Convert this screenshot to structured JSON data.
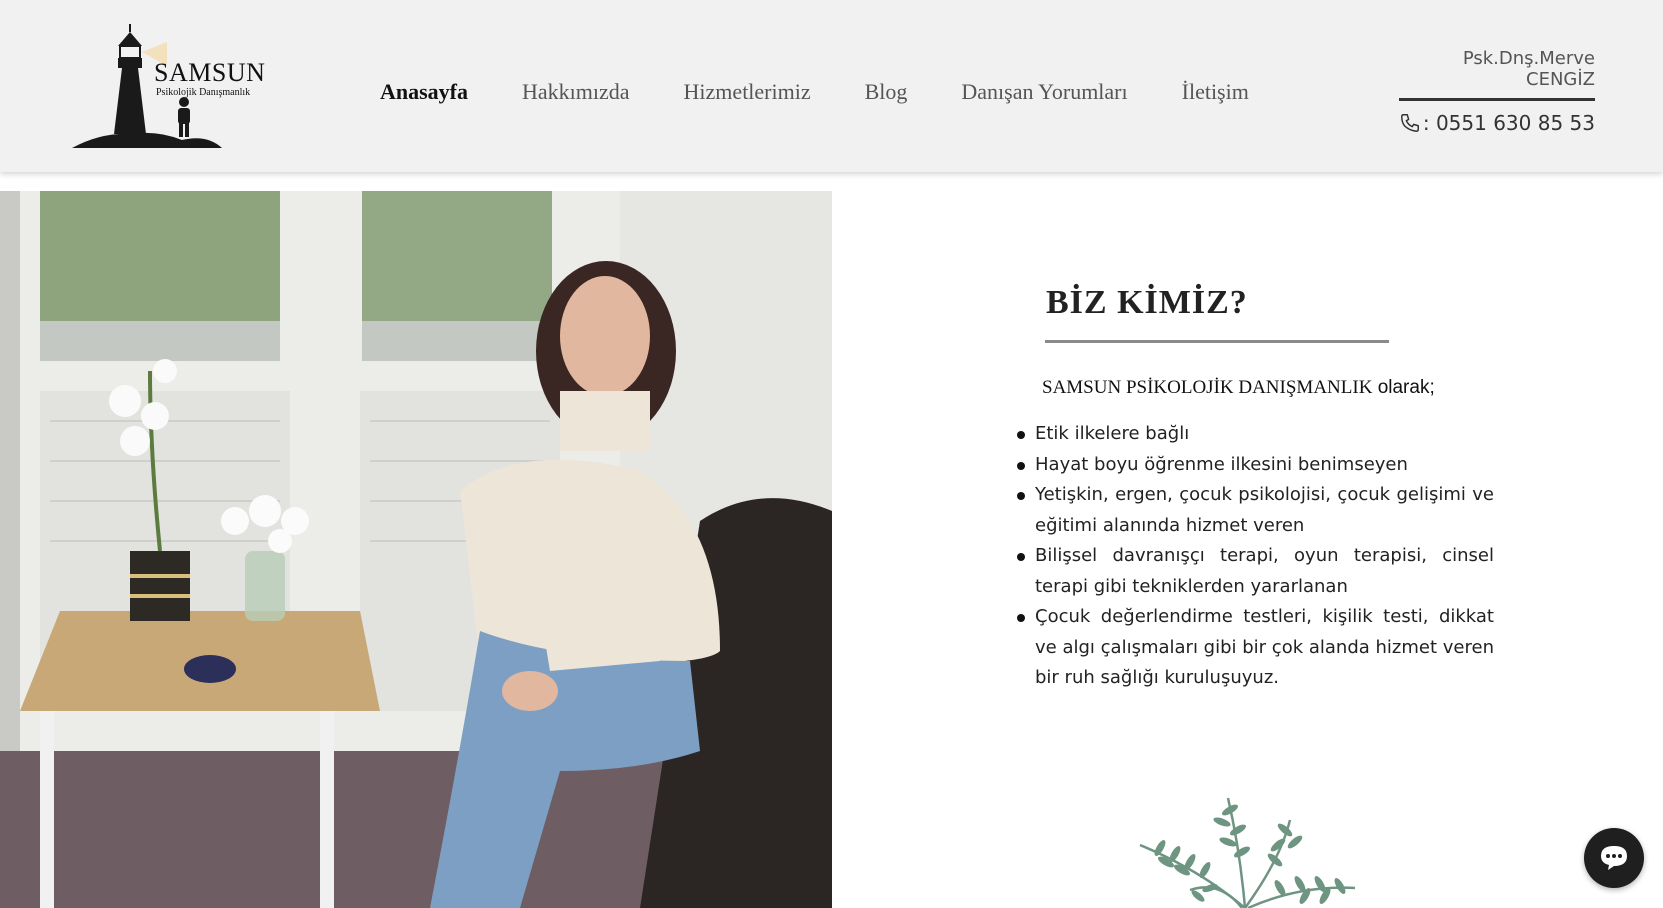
{
  "header": {
    "logo": {
      "title": "SAMSUN",
      "subtitle": "Psikolojik Danışmanlık"
    },
    "nav": [
      {
        "label": "Anasayfa",
        "active": true
      },
      {
        "label": "Hakkımızda",
        "active": false
      },
      {
        "label": "Hizmetlerimiz",
        "active": false
      },
      {
        "label": "Blog",
        "active": false
      },
      {
        "label": "Danışan Yorumları",
        "active": false
      },
      {
        "label": "İletişim",
        "active": false
      }
    ],
    "contact": {
      "name": "Psk.Dnş.Merve CENGİZ",
      "phone": ": 0551 630 85 53",
      "phone_icon": "phone-icon"
    }
  },
  "about": {
    "title": "BİZ KİMİZ?",
    "intro_brand": "SAMSUN PSİKOLOJİK DANIŞMANLIK",
    "intro_suffix": " olarak;",
    "bullets": [
      "Etik ilkelere bağlı",
      "Hayat boyu öğrenme ilkesini benimseyen",
      "Yetişkin, ergen, çocuk psikolojisi, çocuk gelişimi ve eğitimi  alanında hizmet veren",
      "Bilişsel davranışçı terapi, oyun terapisi, cinsel terapi gibi tekniklerden yararlanan",
      "Çocuk değerlendirme  testleri, kişilik testi, dikkat ve algı çalışmaları gibi bir çok alanda hizmet veren bir ruh sağlığı kuruluşuyuz."
    ]
  },
  "chat": {
    "icon": "chat-bubble-icon"
  },
  "colors": {
    "header_bg": "#f1f1f1",
    "plant_green": "#6e9482",
    "rule_gray": "#8a8a8a"
  }
}
